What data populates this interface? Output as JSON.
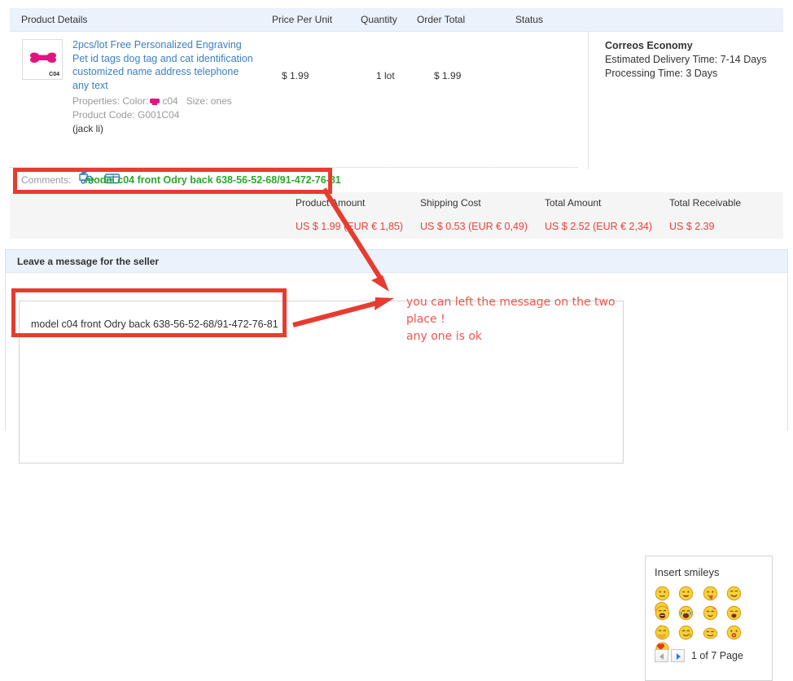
{
  "order_table": {
    "headers": {
      "product_details": "Product Details",
      "price_per_unit": "Price Per Unit",
      "quantity": "Quantity",
      "order_total": "Order Total",
      "status": "Status"
    },
    "row": {
      "thumbnail_code": "C04",
      "title_lines": [
        "2pcs/lot Free Personalized Engraving",
        "Pet id tags dog tag and cat identification",
        "customized name address telephone",
        "any text"
      ],
      "properties": "Properties: Color:",
      "properties_color_value": "c04",
      "properties_size": "Size: ones",
      "product_code": "Product Code: G001C04",
      "buyer": "(jack li)",
      "price_per_unit": "$ 1.99",
      "quantity": "1 lot",
      "order_total": "$ 1.99"
    },
    "shipping": {
      "method": "Correos Economy",
      "delivery_time": "Estimated Delivery Time: 7-14 Days",
      "processing_time": "Processing Time: 3 Days"
    },
    "comments": {
      "label": "Comments:",
      "value": "model c04 front Odry back 638-56-52-68/91-472-76-81"
    },
    "summary": {
      "headers": [
        "Product Amount",
        "Shipping Cost",
        "Total Amount",
        "Total Receivable"
      ],
      "values": [
        "US $ 1.99 (EUR € 1,85)",
        "US $ 0.53 (EUR € 0,49)",
        "US $ 2.52 (EUR € 2,34)",
        "US $ 2.39"
      ]
    }
  },
  "message_panel": {
    "title": "Leave a message for the seller",
    "textarea_value": "model c04 front Odry back 638-56-52-68/91-472-76-81",
    "textarea_placeholder": ""
  },
  "smileys": {
    "title": "Insert smileys",
    "pager_text": "1 of 7 Page",
    "rows": [
      [
        "smiley-neutral",
        "smiley-wink-tongue",
        "smiley-tongue-out",
        "smiley-grin",
        "smiley-drool"
      ],
      [
        "smiley-laugh-open",
        "smiley-cry-laugh",
        "smiley-shy",
        "smiley-hug",
        "smiley-dizzy-stars"
      ],
      [
        "smiley-hand-over-mouth",
        "smiley-giggle",
        "smiley-sideways",
        "smiley-shocked-red",
        "smiley-heart-eyes"
      ]
    ]
  },
  "annotation": {
    "text_lines": [
      "you can left the message on the two",
      "place !",
      "any one is ok"
    ],
    "color": "#f2554d",
    "box_color": "#e83b30"
  },
  "colors": {
    "header_bg": "#eaf2fb",
    "link": "#3b7fc4",
    "amount_red": "#e8403a",
    "comment_green": "#2ca82c",
    "summary_bg": "#f5f5f5"
  }
}
